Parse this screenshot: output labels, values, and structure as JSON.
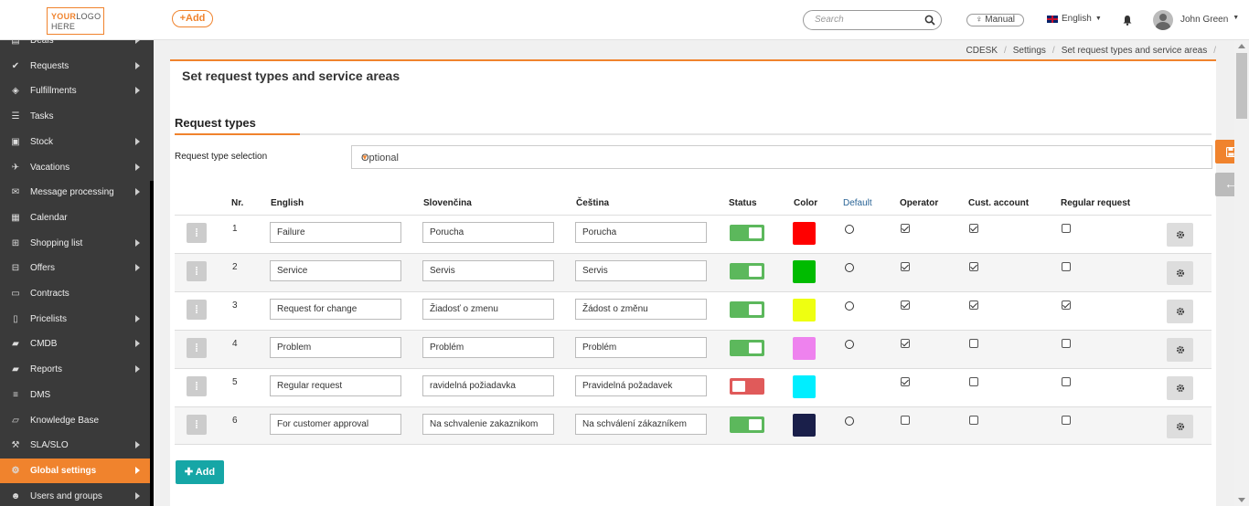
{
  "header": {
    "logo_line1_a": "YOUR",
    "logo_line1_b": "LOGO",
    "logo_line2": "HERE",
    "add_label": "Add",
    "search_placeholder": "Search",
    "manual_label": "Manual",
    "language": "English",
    "user_name": "John Green"
  },
  "sidebar": {
    "items": [
      {
        "label": "Deals",
        "icon": "deals-icon",
        "glyph": "▤",
        "arrow": true
      },
      {
        "label": "Requests",
        "icon": "requests-icon",
        "glyph": "✔",
        "arrow": true
      },
      {
        "label": "Fulfillments",
        "icon": "fulfillments-icon",
        "glyph": "◈",
        "arrow": true
      },
      {
        "label": "Tasks",
        "icon": "tasks-icon",
        "glyph": "☰",
        "arrow": false
      },
      {
        "label": "Stock",
        "icon": "stock-icon",
        "glyph": "▣",
        "arrow": true
      },
      {
        "label": "Vacations",
        "icon": "plane-icon",
        "glyph": "✈",
        "arrow": true
      },
      {
        "label": "Message processing",
        "icon": "envelope-icon",
        "glyph": "✉",
        "arrow": true
      },
      {
        "label": "Calendar",
        "icon": "calendar-icon",
        "glyph": "▦",
        "arrow": false
      },
      {
        "label": "Shopping list",
        "icon": "cart-icon",
        "glyph": "⊞",
        "arrow": true
      },
      {
        "label": "Offers",
        "icon": "gift-icon",
        "glyph": "⊟",
        "arrow": true
      },
      {
        "label": "Contracts",
        "icon": "document-icon",
        "glyph": "▭",
        "arrow": false
      },
      {
        "label": "Pricelists",
        "icon": "pricelist-icon",
        "glyph": "▯",
        "arrow": true
      },
      {
        "label": "CMDB",
        "icon": "folder-icon",
        "glyph": "▰",
        "arrow": true
      },
      {
        "label": "Reports",
        "icon": "reports-folder-icon",
        "glyph": "▰",
        "arrow": true
      },
      {
        "label": "DMS",
        "icon": "database-icon",
        "glyph": "≡",
        "arrow": false
      },
      {
        "label": "Knowledge Base",
        "icon": "book-icon",
        "glyph": "▱",
        "arrow": false
      },
      {
        "label": "SLA/SLO",
        "icon": "gavel-icon",
        "glyph": "⚒",
        "arrow": true
      },
      {
        "label": "Global settings",
        "icon": "cogs-icon",
        "glyph": "⚙",
        "arrow": true,
        "active": true
      },
      {
        "label": "Users and groups",
        "icon": "users-icon",
        "glyph": "☻",
        "arrow": true
      }
    ]
  },
  "breadcrumb": [
    "CDESK",
    "Settings",
    "Set request types and service areas"
  ],
  "page_title": "Set request types and service areas",
  "section_title": "Request types",
  "selection": {
    "label": "Request type selection",
    "value": "Optional"
  },
  "columns": {
    "nr": "Nr.",
    "english": "English",
    "slovak": "Slovenčina",
    "czech": "Čeština",
    "status": "Status",
    "color": "Color",
    "default": "Default",
    "operator": "Operator",
    "cust_account": "Cust. account",
    "regular_request": "Regular request"
  },
  "rows": [
    {
      "nr": "1",
      "english": "Failure",
      "slovak": "Porucha",
      "czech": "Porucha",
      "status": "on",
      "color": "#ff0000",
      "default": true,
      "operator": true,
      "cust_account": true,
      "regular_request": false
    },
    {
      "nr": "2",
      "english": "Service",
      "slovak": "Servis",
      "czech": "Servis",
      "status": "on",
      "color": "#00bb00",
      "default": true,
      "operator": true,
      "cust_account": true,
      "regular_request": false
    },
    {
      "nr": "3",
      "english": "Request for change",
      "slovak": "Žiadosť o zmenu",
      "czech": "Žádost o změnu",
      "status": "on",
      "color": "#eeff11",
      "default": true,
      "operator": true,
      "cust_account": true,
      "regular_request": true
    },
    {
      "nr": "4",
      "english": "Problem",
      "slovak": "Problém",
      "czech": "Problém",
      "status": "on",
      "color": "#ee82ee",
      "default": true,
      "operator": true,
      "cust_account": false,
      "regular_request": false
    },
    {
      "nr": "5",
      "english": "Regular request",
      "slovak": "ravidelná požiadavka",
      "czech": "Pravidelná požadavek",
      "status": "off",
      "color": "#00eeff",
      "default": false,
      "operator": true,
      "cust_account": false,
      "regular_request": false
    },
    {
      "nr": "6",
      "english": "For customer approval",
      "slovak": "Na schvalenie zakaznikom",
      "czech": "Na schválení zákazníkem",
      "status": "on",
      "color": "#1a1f4a",
      "default": true,
      "operator": false,
      "cust_account": false,
      "regular_request": false
    }
  ],
  "add_button": "Add"
}
